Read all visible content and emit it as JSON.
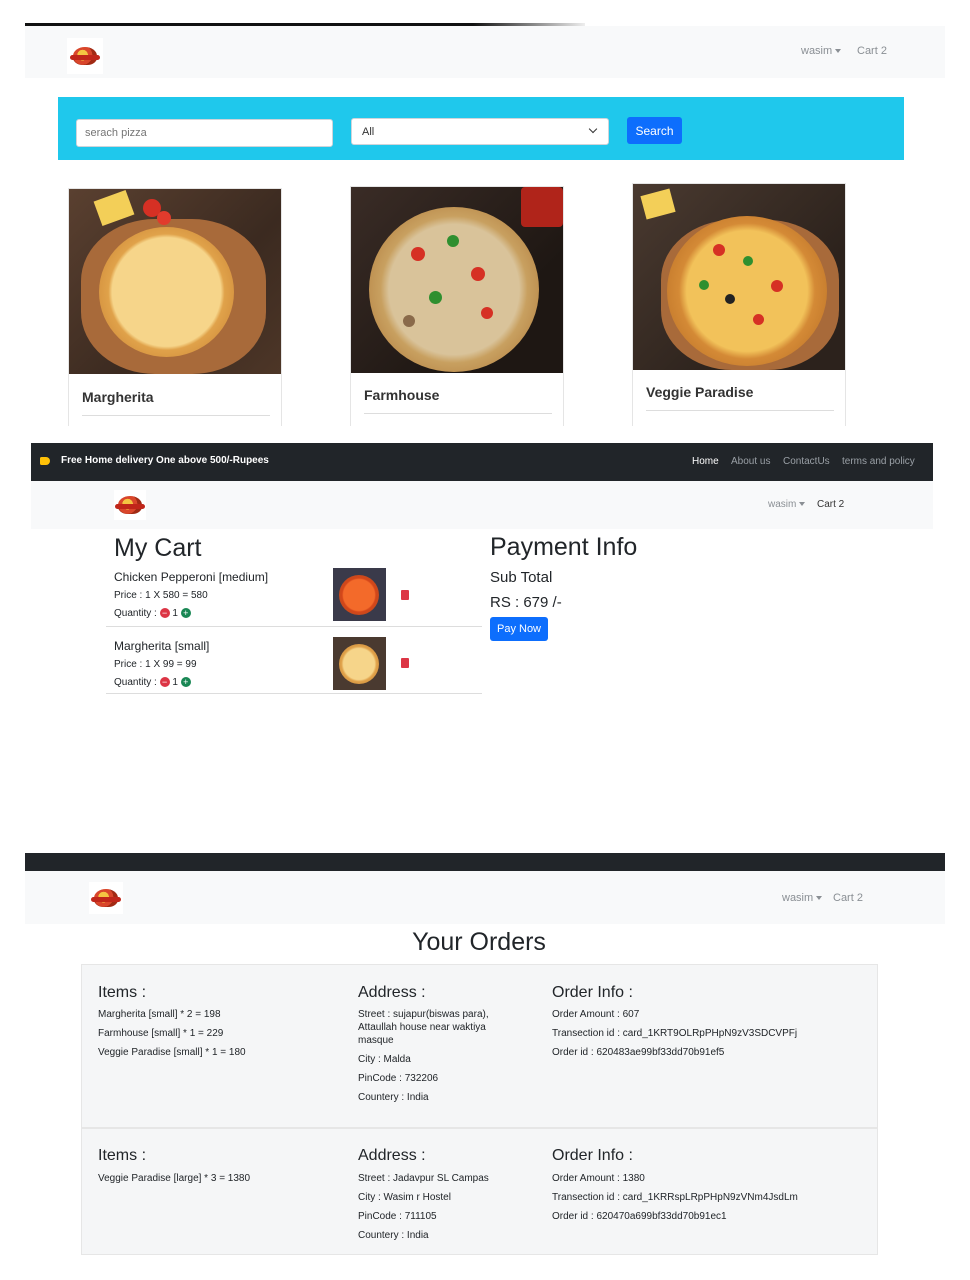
{
  "shop": {
    "nav": {
      "user": "wasim",
      "cart": "Cart 2"
    },
    "search": {
      "placeholder": "serach pizza",
      "category": "All",
      "button": "Search"
    },
    "products": [
      {
        "name": "Margherita"
      },
      {
        "name": "Farmhouse"
      },
      {
        "name": "Veggie Paradise"
      }
    ]
  },
  "topbar": {
    "promo": "Free Home delivery One above 500/-Rupees",
    "links": [
      "Home",
      "About us",
      "ContactUs",
      "terms and policy"
    ]
  },
  "cart_page": {
    "nav": {
      "user": "wasim",
      "cart": "Cart 2"
    },
    "title": "My Cart",
    "items": [
      {
        "name": "Chicken Pepperoni [medium]",
        "price": "Price : 1 X 580 = 580",
        "qty_label": "Quantity :",
        "qty": "1"
      },
      {
        "name": "Margherita [small]",
        "price": "Price : 1 X 99 = 99",
        "qty_label": "Quantity :",
        "qty": "1"
      }
    ],
    "payment": {
      "title": "Payment Info",
      "subtotal_label": "Sub Total",
      "amount": "RS : 679 /-",
      "button": "Pay Now"
    }
  },
  "orders_page": {
    "nav": {
      "user": "wasim",
      "cart": "Cart 2"
    },
    "title": "Your Orders",
    "orders": [
      {
        "items_head": "Items :",
        "items": [
          "Margherita [small] * 2 = 198",
          "Farmhouse [small] * 1 = 229",
          "Veggie Paradise [small] * 1 = 180"
        ],
        "address_head": "Address :",
        "street": "Street : sujapur(biswas para), Attaullah house near waktiya masque",
        "city": "City : Malda",
        "pincode": "PinCode : 732206",
        "country": "Countery : India",
        "info_head": "Order Info :",
        "amount": "Order Amount : 607",
        "txn": "Transection id : card_1KRT9OLRpPHpN9zV3SDCVPFj",
        "order_id": "Order id : 620483ae99bf33dd70b91ef5"
      },
      {
        "items_head": "Items :",
        "items": [
          "Veggie Paradise [large] * 3 = 1380"
        ],
        "address_head": "Address :",
        "street": "Street : Jadavpur SL Campas",
        "city": "City : Wasim r Hostel",
        "pincode": "PinCode : 711105",
        "country": "Countery : India",
        "info_head": "Order Info :",
        "amount": "Order Amount : 1380",
        "txn": "Transection id : card_1KRRspLRpPHpN9zVNm4JsdLm",
        "order_id": "Order id : 620470a699bf33dd70b91ec1"
      }
    ]
  },
  "colors": {
    "accent": "#0d6efd",
    "search_band": "#1fc8ec",
    "dark": "#212529",
    "danger": "#dc3545",
    "success": "#198754"
  },
  "icons": [
    "pizza-logo-icon",
    "chevron-down-icon",
    "tag-icon",
    "trash-icon",
    "minus-circle-icon",
    "plus-circle-icon"
  ]
}
